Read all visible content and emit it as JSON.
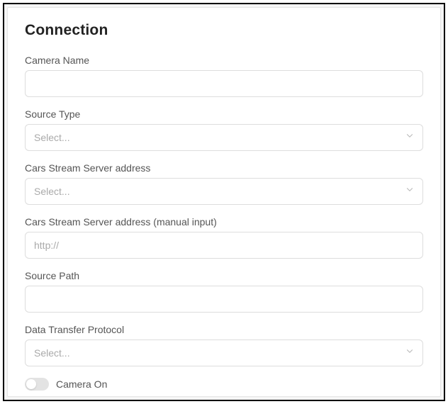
{
  "section": {
    "title": "Connection"
  },
  "form": {
    "camera_name": {
      "label": "Camera Name",
      "value": "",
      "placeholder": ""
    },
    "source_type": {
      "label": "Source Type",
      "selected": "Select..."
    },
    "stream_server": {
      "label": "Cars Stream Server address",
      "selected": "Select..."
    },
    "stream_server_manual": {
      "label": "Cars Stream Server address (manual input)",
      "value": "",
      "placeholder": "http://"
    },
    "source_path": {
      "label": "Source Path",
      "value": "",
      "placeholder": ""
    },
    "transfer_protocol": {
      "label": "Data Transfer Protocol",
      "selected": "Select..."
    },
    "camera_on": {
      "label": "Camera On",
      "state": false
    }
  }
}
